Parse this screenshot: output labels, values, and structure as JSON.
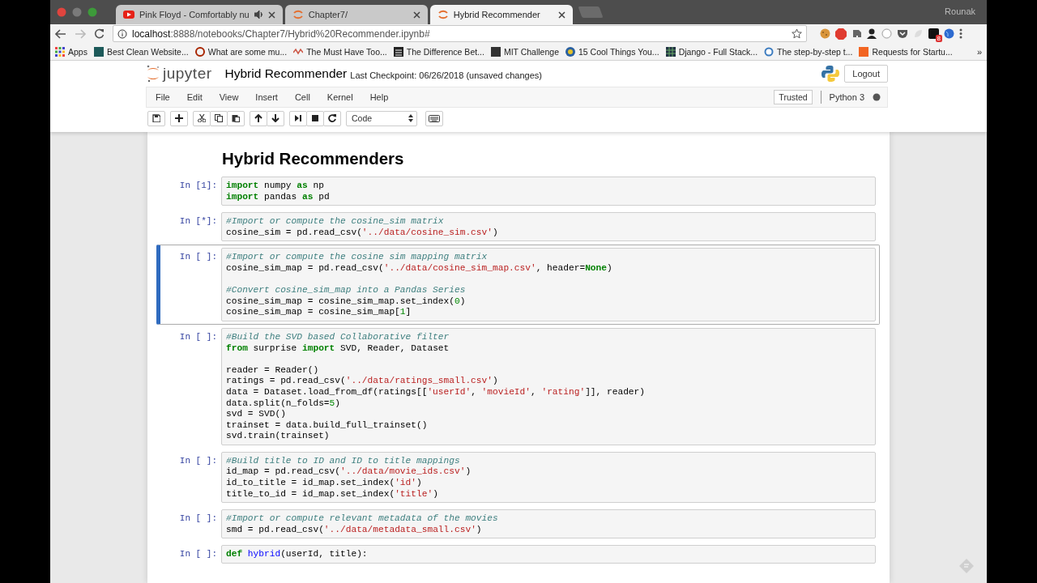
{
  "browser": {
    "tabs": [
      {
        "title": "Pink Floyd - Comfortably nu",
        "audio": true,
        "selected": false
      },
      {
        "title": "Chapter7/",
        "audio": false,
        "selected": false
      },
      {
        "title": "Hybrid Recommender",
        "audio": false,
        "selected": true
      }
    ],
    "profile": "Rounak",
    "url": "**localhost**:8888/notebooks/Chapter7/Hybrid%20Recommender.ipynb#",
    "extension_badge": "8",
    "bookmarks": [
      {
        "label": "Apps"
      },
      {
        "label": "Best Clean Website..."
      },
      {
        "label": "What are some mu..."
      },
      {
        "label": "The Must Have Too..."
      },
      {
        "label": "The Difference Bet..."
      },
      {
        "label": "MIT Challenge"
      },
      {
        "label": "15 Cool Things You..."
      },
      {
        "label": "Django - Full Stack..."
      },
      {
        "label": "The step-by-step t..."
      },
      {
        "label": "Requests for Startu..."
      }
    ],
    "more_bookmarks": "»"
  },
  "jupyter": {
    "logo_text": "jupyter",
    "notebook_name": "Hybrid Recommender",
    "checkpoint": "Last Checkpoint: 06/26/2018 (unsaved changes)",
    "logout": "Logout",
    "menu": [
      "File",
      "Edit",
      "View",
      "Insert",
      "Cell",
      "Kernel",
      "Help"
    ],
    "trusted": "Trusted",
    "kernel_name": "Python 3",
    "kernel_busy": true,
    "cell_type": "Code"
  },
  "notebook": {
    "heading": "Hybrid Recommenders",
    "cells": [
      {
        "prompt": "In [1]:",
        "selected": false,
        "lines": [
          [
            {
              "kind": "keyword",
              "text": "import"
            },
            {
              "kind": "plain",
              "text": " numpy "
            },
            {
              "kind": "keyword",
              "text": "as"
            },
            {
              "kind": "plain",
              "text": " np"
            }
          ],
          [
            {
              "kind": "keyword",
              "text": "import"
            },
            {
              "kind": "plain",
              "text": " pandas "
            },
            {
              "kind": "keyword",
              "text": "as"
            },
            {
              "kind": "plain",
              "text": " pd"
            }
          ]
        ]
      },
      {
        "prompt": "In [*]:",
        "selected": false,
        "lines": [
          [
            {
              "kind": "comment",
              "text": "#Import or compute the cosine_sim matrix"
            }
          ],
          [
            {
              "kind": "plain",
              "text": "cosine_sim = pd.read_csv("
            },
            {
              "kind": "string",
              "text": "'../data/cosine_sim.csv'"
            },
            {
              "kind": "plain",
              "text": ")"
            }
          ]
        ]
      },
      {
        "prompt": "In [ ]:",
        "selected": true,
        "lines": [
          [
            {
              "kind": "comment",
              "text": "#Import or compute the cosine sim mapping matrix"
            }
          ],
          [
            {
              "kind": "plain",
              "text": "cosine_sim_map = pd.read_csv("
            },
            {
              "kind": "string",
              "text": "'../data/cosine_sim_map.csv'"
            },
            {
              "kind": "plain",
              "text": ", header="
            },
            {
              "kind": "keyword",
              "text": "None"
            },
            {
              "kind": "plain",
              "text": ")"
            }
          ],
          [
            {
              "kind": "blank"
            }
          ],
          [
            {
              "kind": "comment",
              "text": "#Convert cosine_sim_map into a Pandas Series"
            }
          ],
          [
            {
              "kind": "plain",
              "text": "cosine_sim_map = cosine_sim_map.set_index("
            },
            {
              "kind": "number",
              "text": "0"
            },
            {
              "kind": "plain",
              "text": ")"
            }
          ],
          [
            {
              "kind": "plain",
              "text": "cosine_sim_map = cosine_sim_map["
            },
            {
              "kind": "number",
              "text": "1"
            },
            {
              "kind": "plain",
              "text": "]"
            }
          ]
        ]
      },
      {
        "prompt": "In [ ]:",
        "selected": false,
        "lines": [
          [
            {
              "kind": "comment",
              "text": "#Build the SVD based Collaborative filter"
            }
          ],
          [
            {
              "kind": "keyword",
              "text": "from"
            },
            {
              "kind": "plain",
              "text": " surprise "
            },
            {
              "kind": "keyword",
              "text": "import"
            },
            {
              "kind": "plain",
              "text": " SVD, Reader, Dataset"
            }
          ],
          [
            {
              "kind": "blank"
            }
          ],
          [
            {
              "kind": "plain",
              "text": "reader = Reader()"
            }
          ],
          [
            {
              "kind": "plain",
              "text": "ratings = pd.read_csv("
            },
            {
              "kind": "string",
              "text": "'../data/ratings_small.csv'"
            },
            {
              "kind": "plain",
              "text": ")"
            }
          ],
          [
            {
              "kind": "plain",
              "text": "data = Dataset.load_from_df(ratings[["
            },
            {
              "kind": "string",
              "text": "'userId'"
            },
            {
              "kind": "plain",
              "text": ", "
            },
            {
              "kind": "string",
              "text": "'movieId'"
            },
            {
              "kind": "plain",
              "text": ", "
            },
            {
              "kind": "string",
              "text": "'rating'"
            },
            {
              "kind": "plain",
              "text": "]], reader)"
            }
          ],
          [
            {
              "kind": "plain",
              "text": "data.split(n_folds="
            },
            {
              "kind": "number",
              "text": "5"
            },
            {
              "kind": "plain",
              "text": ")"
            }
          ],
          [
            {
              "kind": "plain",
              "text": "svd = SVD()"
            }
          ],
          [
            {
              "kind": "plain",
              "text": "trainset = data.build_full_trainset()"
            }
          ],
          [
            {
              "kind": "plain",
              "text": "svd.train(trainset)"
            }
          ]
        ]
      },
      {
        "prompt": "In [ ]:",
        "selected": false,
        "lines": [
          [
            {
              "kind": "comment",
              "text": "#Build title to ID and ID to title mappings"
            }
          ],
          [
            {
              "kind": "plain",
              "text": "id_map = pd.read_csv("
            },
            {
              "kind": "string",
              "text": "'../data/movie_ids.csv'"
            },
            {
              "kind": "plain",
              "text": ")"
            }
          ],
          [
            {
              "kind": "plain",
              "text": "id_to_title = id_map.set_index("
            },
            {
              "kind": "string",
              "text": "'id'"
            },
            {
              "kind": "plain",
              "text": ")"
            }
          ],
          [
            {
              "kind": "plain",
              "text": "title_to_id = id_map.set_index("
            },
            {
              "kind": "string",
              "text": "'title'"
            },
            {
              "kind": "plain",
              "text": ")"
            }
          ]
        ]
      },
      {
        "prompt": "In [ ]:",
        "selected": false,
        "lines": [
          [
            {
              "kind": "comment",
              "text": "#Import or compute relevant metadata of the movies"
            }
          ],
          [
            {
              "kind": "plain",
              "text": "smd = pd.read_csv("
            },
            {
              "kind": "string",
              "text": "'../data/metadata_small.csv'"
            },
            {
              "kind": "plain",
              "text": ")"
            }
          ]
        ]
      },
      {
        "prompt": "In [ ]:",
        "selected": false,
        "lines": [
          [
            {
              "kind": "keyword",
              "text": "def"
            },
            {
              "kind": "function",
              "text": " hybrid"
            },
            {
              "kind": "plain",
              "text": "(userId, title):"
            }
          ]
        ]
      }
    ]
  }
}
